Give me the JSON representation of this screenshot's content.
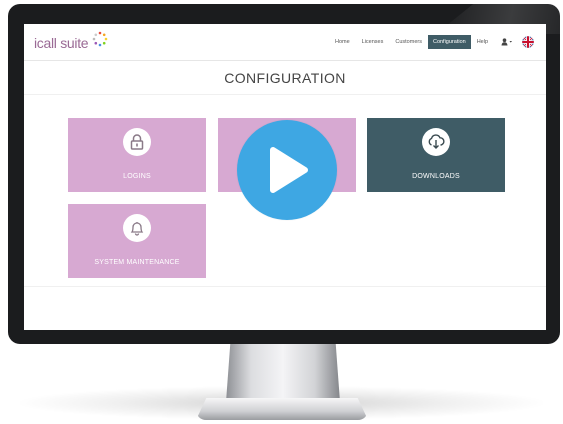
{
  "app": {
    "logo_text": "icall suite"
  },
  "navbar": {
    "items": [
      {
        "label": "Home",
        "active": false
      },
      {
        "label": "Licenses",
        "active": false
      },
      {
        "label": "Customers",
        "active": false
      },
      {
        "label": "Configuration",
        "active": true
      },
      {
        "label": "Help",
        "active": false
      }
    ],
    "user_icon": "user-icon",
    "flag_icon": "uk-flag-icon"
  },
  "page": {
    "title": "CONFIGURATION"
  },
  "tiles": [
    {
      "label": "LOGINS",
      "icon": "lock-icon",
      "color": "#d7a9d2"
    },
    {
      "label": "",
      "icon": "",
      "color": "#d7a9d2"
    },
    {
      "label": "DOWNLOADS",
      "icon": "cloud-download-icon",
      "color": "#3f5c66"
    },
    {
      "label": "SYSTEM MAINTENANCE",
      "icon": "bell-icon",
      "color": "#d7a9d2"
    }
  ],
  "overlay": {
    "icon": "play-icon",
    "color": "#3ea7e3"
  },
  "colors": {
    "accent": "#3f5c66",
    "tile_pink": "#d7a9d2",
    "play_blue": "#3ea7e3",
    "logo": "#9a6a95"
  }
}
